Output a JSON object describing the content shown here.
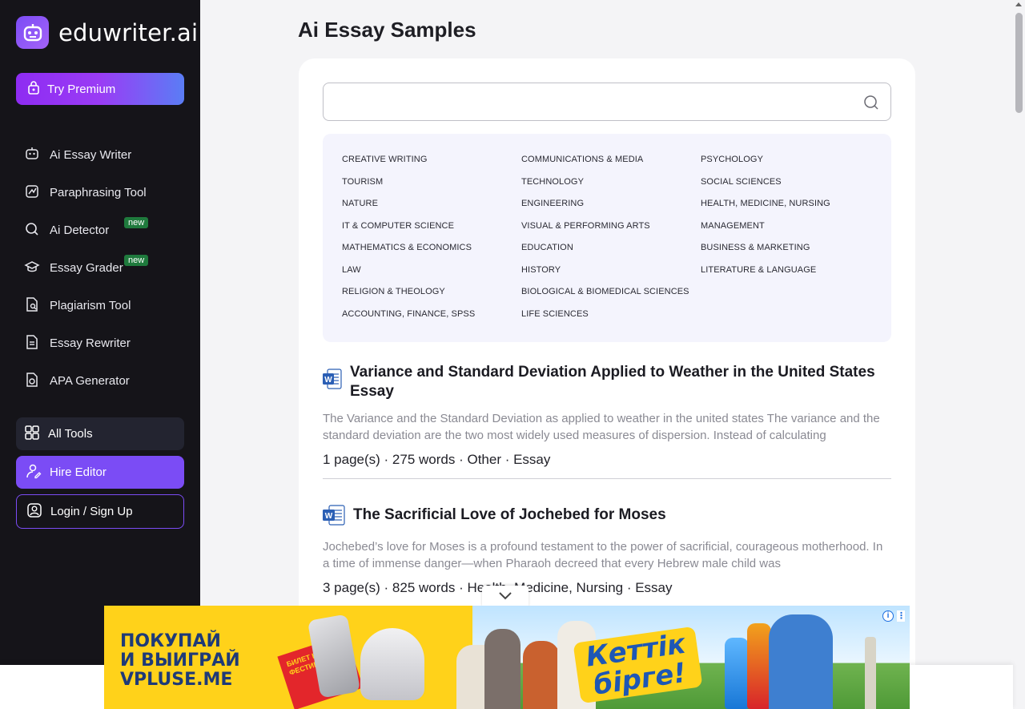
{
  "brand": {
    "name": "eduwriter.ai"
  },
  "sidebar": {
    "premium_label": "Try Premium",
    "items": [
      {
        "label": "Ai Essay Writer",
        "icon": "robot-icon",
        "badge": ""
      },
      {
        "label": "Paraphrasing Tool",
        "icon": "paraphrase-icon",
        "badge": ""
      },
      {
        "label": "Ai Detector",
        "icon": "search-icon",
        "badge": "new"
      },
      {
        "label": "Essay Grader",
        "icon": "graduation-cap-icon",
        "badge": "new"
      },
      {
        "label": "Plagiarism Tool",
        "icon": "document-search-icon",
        "badge": ""
      },
      {
        "label": "Essay Rewriter",
        "icon": "document-icon",
        "badge": ""
      },
      {
        "label": "APA Generator",
        "icon": "file-cite-icon",
        "badge": ""
      }
    ],
    "all_tools_label": "All Tools",
    "hire_editor_label": "Hire Editor",
    "login_label": "Login / Sign Up"
  },
  "main": {
    "title": "Ai Essay Samples",
    "search": {
      "placeholder": "",
      "value": ""
    },
    "categories": [
      [
        "Creative Writing",
        "Tourism",
        "Nature",
        "IT & Computer Science",
        "Mathematics & Economics",
        "Law",
        "Religion & Theology",
        "Accounting, Finance, SPSS"
      ],
      [
        "Communications & Media",
        "Technology",
        "Engineering",
        "Visual & Performing Arts",
        "Education",
        "History",
        "Biological & Biomedical Sciences",
        "Life Sciences"
      ],
      [
        "Psychology",
        "Social Sciences",
        "Health, Medicine, Nursing",
        "Management",
        "Business & Marketing",
        "Literature & Language"
      ]
    ],
    "essays": [
      {
        "title": "Variance and Standard Deviation Applied to Weather in the United States Essay",
        "excerpt": "The Variance and the Standard Deviation as applied to weather in the united states The variance and the standard deviation are the two most widely used measures of dispersion. Instead of calculating",
        "meta": "1 page(s) · 275 words · Other · Essay"
      },
      {
        "title": "The Sacrificial Love of Jochebed for Moses",
        "excerpt": "Jochebed’s love for Moses is a profound testament to the power of sacrificial, courageous motherhood. In a time of immense danger—when Pharaoh decreed that every Hebrew male child was",
        "meta": "3 page(s) · 825 words · Health, Medicine, Nursing · Essay"
      }
    ]
  },
  "ad": {
    "line1": "ПОКУПАЙ",
    "line2": "И ВЫИГРАЙ",
    "url": "VPLUSE.ME",
    "slogan_1": "Кеттік",
    "slogan_2": "бірге!",
    "ticket": "БИЛЕТ НА ФЕСТИВАЛЬ",
    "info": "i",
    "menu": "⋮"
  },
  "colors": {
    "sidebar_bg": "#151419",
    "accent": "#7b4cf5",
    "badge_green": "#1f7a3d",
    "ad_yellow": "#ffd21a"
  }
}
